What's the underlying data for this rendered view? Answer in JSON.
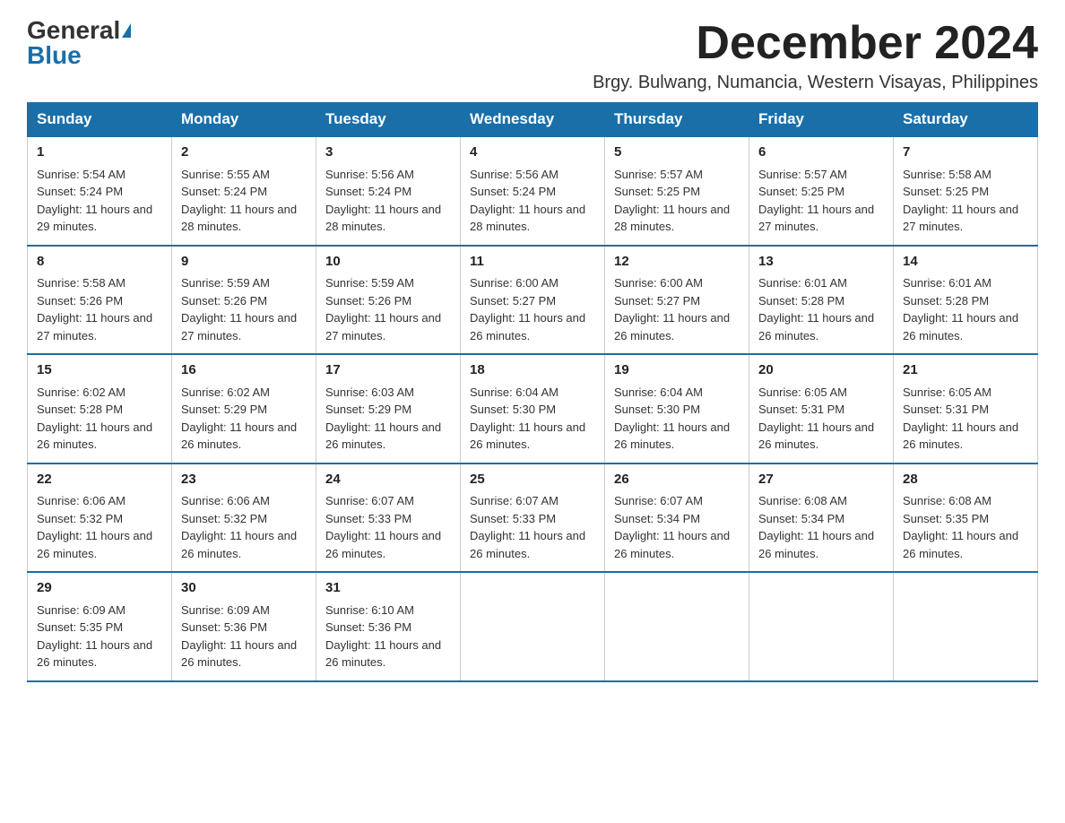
{
  "logo": {
    "general": "General",
    "blue": "Blue"
  },
  "title": "December 2024",
  "subtitle": "Brgy. Bulwang, Numancia, Western Visayas, Philippines",
  "days_of_week": [
    "Sunday",
    "Monday",
    "Tuesday",
    "Wednesday",
    "Thursday",
    "Friday",
    "Saturday"
  ],
  "weeks": [
    [
      {
        "day": "1",
        "sunrise": "Sunrise: 5:54 AM",
        "sunset": "Sunset: 5:24 PM",
        "daylight": "Daylight: 11 hours and 29 minutes."
      },
      {
        "day": "2",
        "sunrise": "Sunrise: 5:55 AM",
        "sunset": "Sunset: 5:24 PM",
        "daylight": "Daylight: 11 hours and 28 minutes."
      },
      {
        "day": "3",
        "sunrise": "Sunrise: 5:56 AM",
        "sunset": "Sunset: 5:24 PM",
        "daylight": "Daylight: 11 hours and 28 minutes."
      },
      {
        "day": "4",
        "sunrise": "Sunrise: 5:56 AM",
        "sunset": "Sunset: 5:24 PM",
        "daylight": "Daylight: 11 hours and 28 minutes."
      },
      {
        "day": "5",
        "sunrise": "Sunrise: 5:57 AM",
        "sunset": "Sunset: 5:25 PM",
        "daylight": "Daylight: 11 hours and 28 minutes."
      },
      {
        "day": "6",
        "sunrise": "Sunrise: 5:57 AM",
        "sunset": "Sunset: 5:25 PM",
        "daylight": "Daylight: 11 hours and 27 minutes."
      },
      {
        "day": "7",
        "sunrise": "Sunrise: 5:58 AM",
        "sunset": "Sunset: 5:25 PM",
        "daylight": "Daylight: 11 hours and 27 minutes."
      }
    ],
    [
      {
        "day": "8",
        "sunrise": "Sunrise: 5:58 AM",
        "sunset": "Sunset: 5:26 PM",
        "daylight": "Daylight: 11 hours and 27 minutes."
      },
      {
        "day": "9",
        "sunrise": "Sunrise: 5:59 AM",
        "sunset": "Sunset: 5:26 PM",
        "daylight": "Daylight: 11 hours and 27 minutes."
      },
      {
        "day": "10",
        "sunrise": "Sunrise: 5:59 AM",
        "sunset": "Sunset: 5:26 PM",
        "daylight": "Daylight: 11 hours and 27 minutes."
      },
      {
        "day": "11",
        "sunrise": "Sunrise: 6:00 AM",
        "sunset": "Sunset: 5:27 PM",
        "daylight": "Daylight: 11 hours and 26 minutes."
      },
      {
        "day": "12",
        "sunrise": "Sunrise: 6:00 AM",
        "sunset": "Sunset: 5:27 PM",
        "daylight": "Daylight: 11 hours and 26 minutes."
      },
      {
        "day": "13",
        "sunrise": "Sunrise: 6:01 AM",
        "sunset": "Sunset: 5:28 PM",
        "daylight": "Daylight: 11 hours and 26 minutes."
      },
      {
        "day": "14",
        "sunrise": "Sunrise: 6:01 AM",
        "sunset": "Sunset: 5:28 PM",
        "daylight": "Daylight: 11 hours and 26 minutes."
      }
    ],
    [
      {
        "day": "15",
        "sunrise": "Sunrise: 6:02 AM",
        "sunset": "Sunset: 5:28 PM",
        "daylight": "Daylight: 11 hours and 26 minutes."
      },
      {
        "day": "16",
        "sunrise": "Sunrise: 6:02 AM",
        "sunset": "Sunset: 5:29 PM",
        "daylight": "Daylight: 11 hours and 26 minutes."
      },
      {
        "day": "17",
        "sunrise": "Sunrise: 6:03 AM",
        "sunset": "Sunset: 5:29 PM",
        "daylight": "Daylight: 11 hours and 26 minutes."
      },
      {
        "day": "18",
        "sunrise": "Sunrise: 6:04 AM",
        "sunset": "Sunset: 5:30 PM",
        "daylight": "Daylight: 11 hours and 26 minutes."
      },
      {
        "day": "19",
        "sunrise": "Sunrise: 6:04 AM",
        "sunset": "Sunset: 5:30 PM",
        "daylight": "Daylight: 11 hours and 26 minutes."
      },
      {
        "day": "20",
        "sunrise": "Sunrise: 6:05 AM",
        "sunset": "Sunset: 5:31 PM",
        "daylight": "Daylight: 11 hours and 26 minutes."
      },
      {
        "day": "21",
        "sunrise": "Sunrise: 6:05 AM",
        "sunset": "Sunset: 5:31 PM",
        "daylight": "Daylight: 11 hours and 26 minutes."
      }
    ],
    [
      {
        "day": "22",
        "sunrise": "Sunrise: 6:06 AM",
        "sunset": "Sunset: 5:32 PM",
        "daylight": "Daylight: 11 hours and 26 minutes."
      },
      {
        "day": "23",
        "sunrise": "Sunrise: 6:06 AM",
        "sunset": "Sunset: 5:32 PM",
        "daylight": "Daylight: 11 hours and 26 minutes."
      },
      {
        "day": "24",
        "sunrise": "Sunrise: 6:07 AM",
        "sunset": "Sunset: 5:33 PM",
        "daylight": "Daylight: 11 hours and 26 minutes."
      },
      {
        "day": "25",
        "sunrise": "Sunrise: 6:07 AM",
        "sunset": "Sunset: 5:33 PM",
        "daylight": "Daylight: 11 hours and 26 minutes."
      },
      {
        "day": "26",
        "sunrise": "Sunrise: 6:07 AM",
        "sunset": "Sunset: 5:34 PM",
        "daylight": "Daylight: 11 hours and 26 minutes."
      },
      {
        "day": "27",
        "sunrise": "Sunrise: 6:08 AM",
        "sunset": "Sunset: 5:34 PM",
        "daylight": "Daylight: 11 hours and 26 minutes."
      },
      {
        "day": "28",
        "sunrise": "Sunrise: 6:08 AM",
        "sunset": "Sunset: 5:35 PM",
        "daylight": "Daylight: 11 hours and 26 minutes."
      }
    ],
    [
      {
        "day": "29",
        "sunrise": "Sunrise: 6:09 AM",
        "sunset": "Sunset: 5:35 PM",
        "daylight": "Daylight: 11 hours and 26 minutes."
      },
      {
        "day": "30",
        "sunrise": "Sunrise: 6:09 AM",
        "sunset": "Sunset: 5:36 PM",
        "daylight": "Daylight: 11 hours and 26 minutes."
      },
      {
        "day": "31",
        "sunrise": "Sunrise: 6:10 AM",
        "sunset": "Sunset: 5:36 PM",
        "daylight": "Daylight: 11 hours and 26 minutes."
      },
      null,
      null,
      null,
      null
    ]
  ]
}
